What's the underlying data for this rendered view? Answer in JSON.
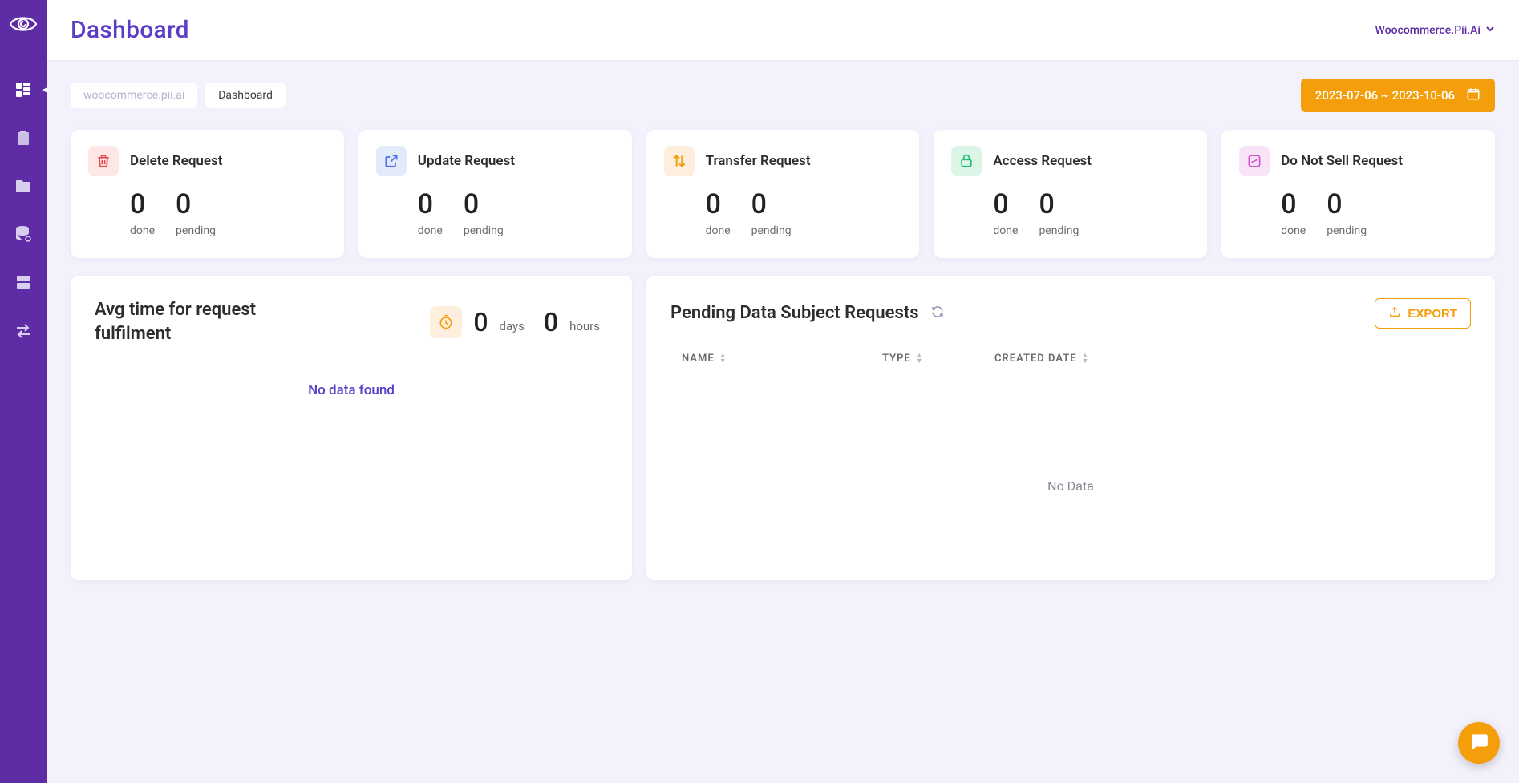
{
  "header": {
    "title": "Dashboard",
    "tenant": "Woocommerce.Pii.Ai"
  },
  "breadcrumbs": {
    "site": "woocommerce.pii.ai",
    "page": "Dashboard"
  },
  "date_range": "2023-07-06 ~ 2023-10-06",
  "stat_cards": [
    {
      "label": "Delete Request",
      "done": "0",
      "pending": "0",
      "done_label": "done",
      "pending_label": "pending"
    },
    {
      "label": "Update Request",
      "done": "0",
      "pending": "0",
      "done_label": "done",
      "pending_label": "pending"
    },
    {
      "label": "Transfer Request",
      "done": "0",
      "pending": "0",
      "done_label": "done",
      "pending_label": "pending"
    },
    {
      "label": "Access Request",
      "done": "0",
      "pending": "0",
      "done_label": "done",
      "pending_label": "pending"
    },
    {
      "label": "Do Not Sell Request",
      "done": "0",
      "pending": "0",
      "done_label": "done",
      "pending_label": "pending"
    }
  ],
  "avg_panel": {
    "title": "Avg time for request fulfilment",
    "days_value": "0",
    "days_label": "days",
    "hours_value": "0",
    "hours_label": "hours",
    "no_data": "No data found"
  },
  "pending_panel": {
    "title": "Pending Data Subject Requests",
    "export_label": "EXPORT",
    "columns": {
      "name": "NAME",
      "type": "TYPE",
      "created": "CREATED DATE"
    },
    "empty": "No Data"
  }
}
